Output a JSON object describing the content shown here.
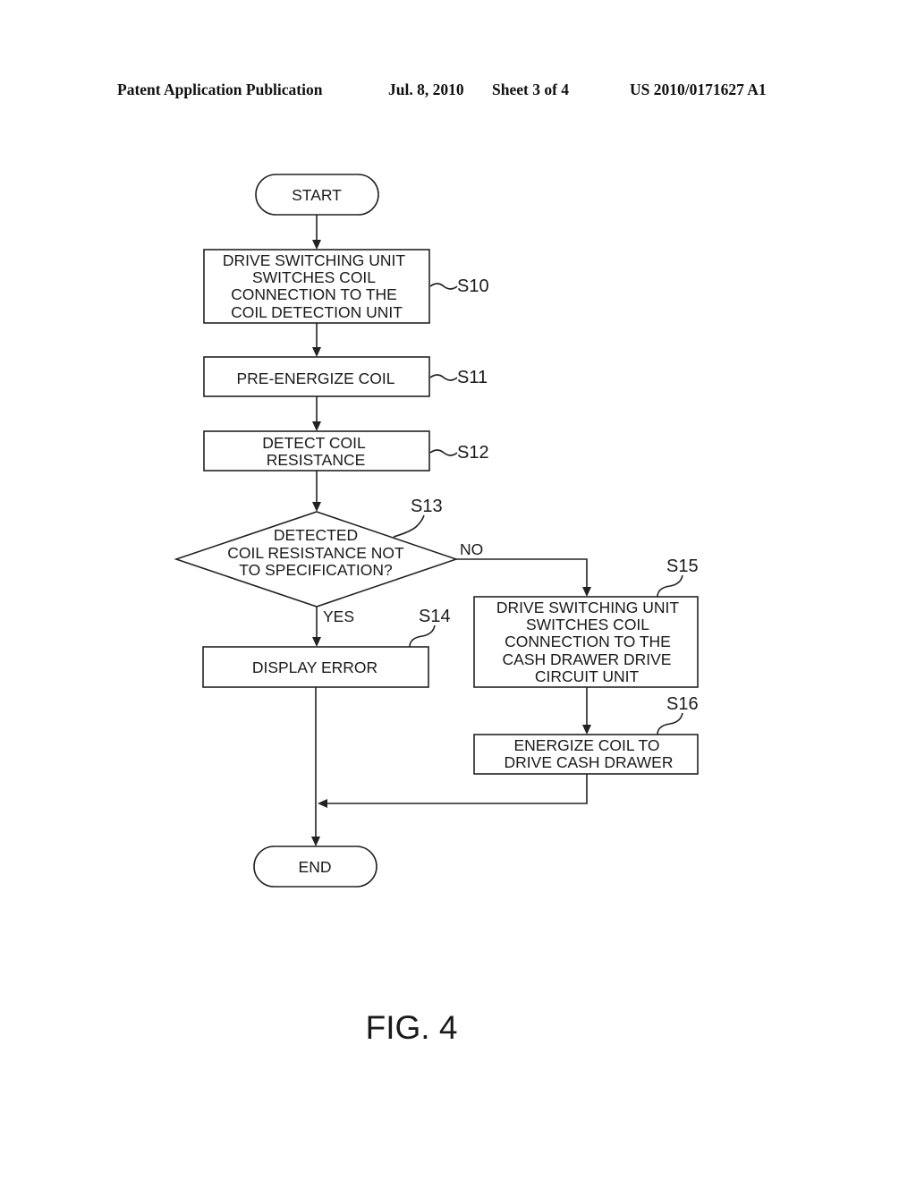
{
  "header": {
    "publication": "Patent Application Publication",
    "date": "Jul. 8, 2010",
    "sheet": "Sheet 3 of 4",
    "number": "US 2010/0171627 A1"
  },
  "flowchart": {
    "start": "START",
    "end": "END",
    "steps": [
      {
        "id": "S10",
        "lines": [
          "DRIVE SWITCHING UNIT",
          "SWITCHES COIL",
          "CONNECTION TO THE",
          "COIL DETECTION UNIT"
        ]
      },
      {
        "id": "S11",
        "lines": [
          "PRE-ENERGIZE COIL"
        ]
      },
      {
        "id": "S12",
        "lines": [
          "DETECT COIL",
          "RESISTANCE"
        ]
      },
      {
        "id": "S13",
        "lines": [
          "DETECTED",
          "COIL RESISTANCE NOT",
          "TO SPECIFICATION?"
        ]
      },
      {
        "id": "S14",
        "lines": [
          "DISPLAY ERROR"
        ]
      },
      {
        "id": "S15",
        "lines": [
          "DRIVE SWITCHING UNIT",
          "SWITCHES COIL",
          "CONNECTION TO THE",
          "CASH DRAWER DRIVE",
          "CIRCUIT UNIT"
        ]
      },
      {
        "id": "S16",
        "lines": [
          "ENERGIZE COIL TO",
          "DRIVE CASH DRAWER"
        ]
      }
    ],
    "yes_label": "YES",
    "no_label": "NO"
  },
  "figure_label": "FIG. 4"
}
